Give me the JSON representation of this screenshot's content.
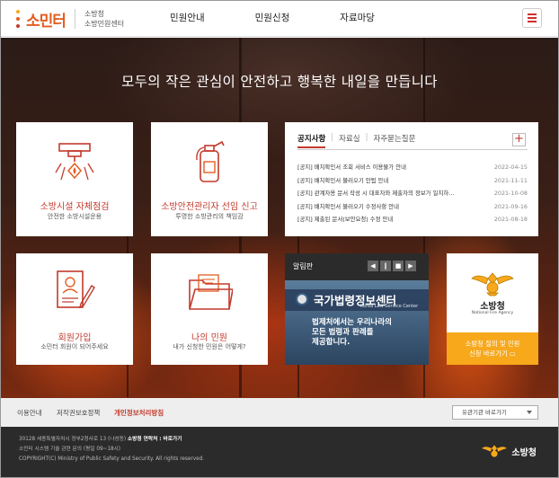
{
  "header": {
    "logo_text": "소민터",
    "logo_sub_line1": "소방청",
    "logo_sub_line2": "소방민원센터",
    "nav": [
      "민원안내",
      "민원신청",
      "자료마당"
    ]
  },
  "hero": {
    "tagline": "모두의 작은 관심이 안전하고 행복한 내일을 만듭니다"
  },
  "tiles": {
    "inspection": {
      "title": "소방시설 자체점검",
      "sub": "안전한 소방시설운용"
    },
    "manager": {
      "title": "소방안전관리자 선임 신고",
      "sub": "투명한 소방관리의 책임감"
    },
    "join": {
      "title": "회원가입",
      "sub": "소민터 회원이 되어주세요"
    },
    "my": {
      "title": "나의 민원",
      "sub": "내가 신청한 민원은 어떻게?"
    }
  },
  "board": {
    "tabs": [
      "공지사항",
      "자료실",
      "자주묻는질문"
    ],
    "plus": "+",
    "notices": [
      {
        "title": "[공지] 배치확인서 조회 서비스 이용불가 안내",
        "date": "2022-04-15"
      },
      {
        "title": "[공지] 배치확인서 불러오기 안됨 안내",
        "date": "2021-11-11"
      },
      {
        "title": "[공지] 관계자용 문서 작성 시 대표자와 제출자의 정보가 일치하...",
        "date": "2021-10-08"
      },
      {
        "title": "[공지] 배치확인서 불러오기 수정사항 안내",
        "date": "2021-09-16"
      },
      {
        "title": "[공지] 제출된 문서(보안요청) 수정 안내",
        "date": "2021-08-18"
      }
    ]
  },
  "alarm": {
    "title": "알림판",
    "controls": [
      "◀",
      "‖",
      "■",
      "▶"
    ],
    "banner_name": "국가법령정보센터",
    "banner_en": "Korea Law Service Center",
    "banner_line1": "법제처에서는 우리나라의",
    "banner_line2": "모든 법령과 판례를",
    "banner_line3": "제공합니다."
  },
  "agency": {
    "name": "소방청",
    "en": "National Fire Agency",
    "cta_line1": "소방청 질의 및 민원",
    "cta_line2": "신청 바로가기 ▭"
  },
  "footer": {
    "links": [
      "이용안내",
      "저작권보호정책",
      "개인정보처리방침"
    ],
    "family_select": "유관기관 바로가기",
    "address": "30128 세종특별자치시 정부2청사로 13 (나성동)",
    "address_bold": "소방청 연락처 : 바로가기",
    "line2": "소민터 시스템 기술 관련 문의 (평일 09~18시)",
    "copyright": "COPYRIGHT(C) Ministry of Public Safety and Security. All rights reserved.",
    "logo_text": "소방청"
  },
  "colors": {
    "accent": "#c23a2c",
    "cta": "#f7a81b",
    "footer": "#2b2b2b"
  }
}
